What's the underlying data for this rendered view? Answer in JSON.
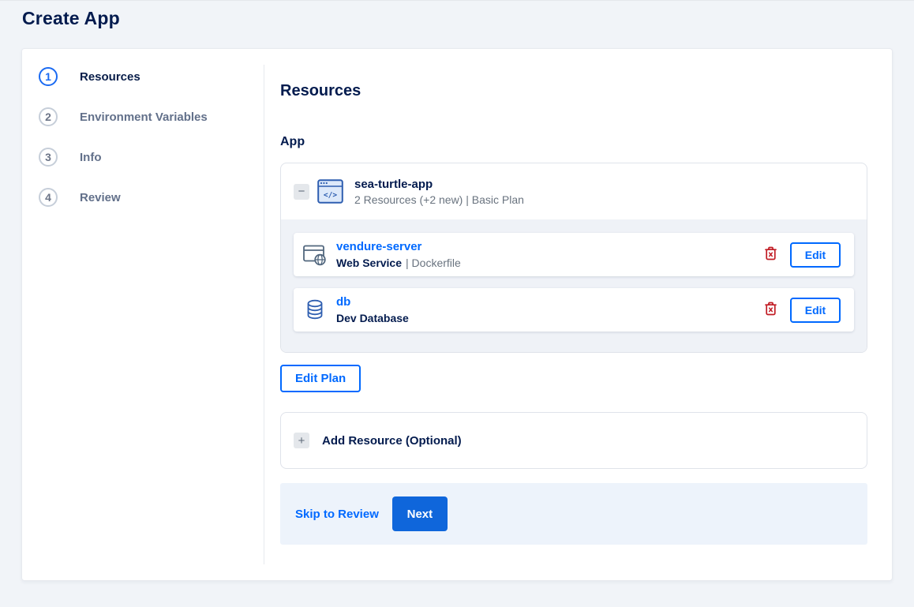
{
  "header": {
    "title": "Create App"
  },
  "stepper": {
    "steps": [
      {
        "number": "1",
        "label": "Resources",
        "active": true
      },
      {
        "number": "2",
        "label": "Environment Variables",
        "active": false
      },
      {
        "number": "3",
        "label": "Info",
        "active": false
      },
      {
        "number": "4",
        "label": "Review",
        "active": false
      }
    ]
  },
  "content": {
    "heading": "Resources",
    "section_label": "App",
    "app": {
      "name": "sea-turtle-app",
      "summary": "2 Resources (+2 new) | Basic Plan",
      "icon": "code-window-icon",
      "resources": [
        {
          "name": "vendure-server",
          "type": "Web Service",
          "detail": "| Dockerfile",
          "icon": "web-service-icon",
          "delete_icon": "trash-icon",
          "edit_label": "Edit"
        },
        {
          "name": "db",
          "type": "Dev Database",
          "detail": "",
          "icon": "database-icon",
          "delete_icon": "trash-icon",
          "edit_label": "Edit"
        }
      ]
    },
    "edit_plan_label": "Edit Plan",
    "add_resource_label": "Add Resource (Optional)",
    "footer": {
      "skip_label": "Skip to Review",
      "next_label": "Next"
    }
  },
  "icons": {
    "collapse": "−",
    "add": "+"
  },
  "colors": {
    "accent_blue": "#0069ff",
    "button_blue": "#0f66db",
    "navy_text": "#031b4e",
    "gray_text": "#69737f",
    "danger_red": "#c11c24",
    "page_background": "#f1f4f8",
    "footer_background": "#edf3fb"
  }
}
